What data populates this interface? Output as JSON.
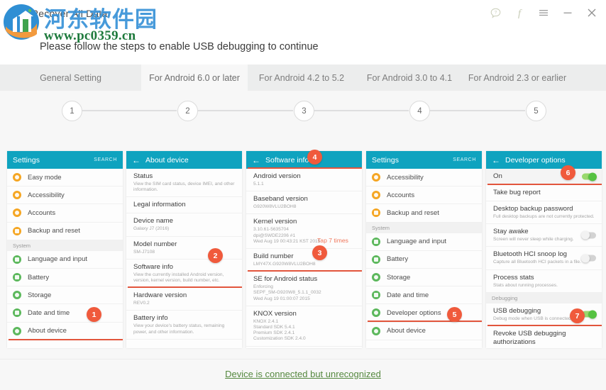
{
  "window": {
    "title": "Recover All Data",
    "watermark_cn": "河东软件园",
    "watermark_url": "www.pc0359.cn",
    "controls": [
      {
        "name": "help-icon",
        "glyph": "?"
      },
      {
        "name": "facebook-icon",
        "glyph": "f"
      },
      {
        "name": "menu-icon",
        "glyph": "≡"
      },
      {
        "name": "minimize-icon",
        "glyph": "–"
      },
      {
        "name": "close-icon",
        "glyph": "✕"
      }
    ]
  },
  "instruction": "Please follow the steps to enable USB debugging to continue",
  "tabs": [
    {
      "label": "General Setting",
      "active": false
    },
    {
      "label": "For Android 6.0 or later",
      "active": true
    },
    {
      "label": "For Android 4.2 to 5.2",
      "active": false
    },
    {
      "label": "For Android 3.0 to 4.1",
      "active": false
    },
    {
      "label": "For Android 2.3 or earlier",
      "active": false
    }
  ],
  "steps": [
    "1",
    "2",
    "3",
    "4",
    "5"
  ],
  "colors": {
    "accent_teal": "#0fa3bf",
    "badge_red": "#f05a3c",
    "underline_red": "#e2553c",
    "toggle_green": "#56c242",
    "link_green": "#55883f",
    "tap_hint": "#f0775c"
  },
  "panels": [
    {
      "name": "panel-settings-1",
      "header": {
        "title": "Settings",
        "back": false,
        "search": "SEARCH"
      },
      "badge": "1",
      "tap_hint": null,
      "rows": [
        {
          "type": "item",
          "label": "Easy mode",
          "icon_color": "#f5a623",
          "shape": "round"
        },
        {
          "type": "item",
          "label": "Accessibility",
          "icon_color": "#f5a623",
          "shape": "round"
        },
        {
          "type": "item",
          "label": "Accounts",
          "icon_color": "#f5a623",
          "shape": "round"
        },
        {
          "type": "item",
          "label": "Backup and reset",
          "icon_color": "#f5a623",
          "shape": "square"
        },
        {
          "type": "section",
          "label": "System"
        },
        {
          "type": "item",
          "label": "Language and input",
          "icon_color": "#5cb85c",
          "shape": "square"
        },
        {
          "type": "item",
          "label": "Battery",
          "icon_color": "#5cb85c",
          "shape": "square"
        },
        {
          "type": "item",
          "label": "Storage",
          "icon_color": "#5cb85c",
          "shape": "round"
        },
        {
          "type": "item",
          "label": "Date and time",
          "icon_color": "#5cb85c",
          "shape": "square"
        },
        {
          "type": "item",
          "label": "About device",
          "icon_color": "#5cb85c",
          "shape": "round",
          "highlight": true
        }
      ]
    },
    {
      "name": "panel-about-device",
      "header": {
        "title": "About device",
        "back": true,
        "search": null
      },
      "badge": "2",
      "tap_hint": null,
      "rows": [
        {
          "type": "detail",
          "title": "Status",
          "sub": "View the SIM card status, device IMEI, and other information."
        },
        {
          "type": "detail",
          "title": "Legal information",
          "sub": ""
        },
        {
          "type": "detail",
          "title": "Device name",
          "sub": "Galaxy J7 (2016)"
        },
        {
          "type": "detail",
          "title": "Model number",
          "sub": "SM-J7108"
        },
        {
          "type": "detail",
          "title": "Software info",
          "sub": "View the currently installed Android version, version, kernel version, build number, etc.",
          "highlight": true
        },
        {
          "type": "detail",
          "title": "Hardware version",
          "sub": "REV0.2"
        },
        {
          "type": "detail",
          "title": "Battery info",
          "sub": "View your device's battery status, remaining power, and other information."
        }
      ]
    },
    {
      "name": "panel-software-info",
      "header": {
        "title": "Software info",
        "back": true,
        "search": null
      },
      "badge": "3",
      "header_badge": "4",
      "tap_hint": "Tap 7 times",
      "rows": [
        {
          "type": "detail",
          "title": "Android version",
          "sub": "5.1.1"
        },
        {
          "type": "detail",
          "title": "Baseband version",
          "sub": "G920W8VLU2BOH8"
        },
        {
          "type": "detail",
          "title": "Kernel version",
          "sub": "3.10.61-5635704\ndpi@SWDE2206 #1\nWed Aug 19 00:43:21 KST 2015"
        },
        {
          "type": "detail",
          "title": "Build number",
          "sub": "LMY47X.G920W8VLU2BOH8",
          "highlight": true
        },
        {
          "type": "detail",
          "title": "SE for Android status",
          "sub": "Enforcing\nSEPF_SM-G920W8_5.1.1_0032\nWed Aug 19 01:00:07 2015"
        },
        {
          "type": "detail",
          "title": "KNOX version",
          "sub": "KNOX 2.4.1\nStandard SDK 5.4.1\nPremium SDK 2.4.1\nCustomization SDK 2.4.0"
        }
      ]
    },
    {
      "name": "panel-settings-2",
      "header": {
        "title": "Settings",
        "back": false,
        "search": "SEARCH"
      },
      "badge": "5",
      "tap_hint": null,
      "rows": [
        {
          "type": "item",
          "label": "Accessibility",
          "icon_color": "#f5a623",
          "shape": "round"
        },
        {
          "type": "item",
          "label": "Accounts",
          "icon_color": "#f5a623",
          "shape": "round"
        },
        {
          "type": "item",
          "label": "Backup and reset",
          "icon_color": "#f5a623",
          "shape": "square"
        },
        {
          "type": "section",
          "label": "System"
        },
        {
          "type": "item",
          "label": "Language and input",
          "icon_color": "#5cb85c",
          "shape": "square"
        },
        {
          "type": "item",
          "label": "Battery",
          "icon_color": "#5cb85c",
          "shape": "square"
        },
        {
          "type": "item",
          "label": "Storage",
          "icon_color": "#5cb85c",
          "shape": "round"
        },
        {
          "type": "item",
          "label": "Date and time",
          "icon_color": "#5cb85c",
          "shape": "square"
        },
        {
          "type": "item",
          "label": "Developer options",
          "icon_color": "#5cb85c",
          "shape": "round",
          "highlight": true
        },
        {
          "type": "item",
          "label": "About device",
          "icon_color": "#5cb85c",
          "shape": "round"
        }
      ]
    },
    {
      "name": "panel-developer-options",
      "header": {
        "title": "Developer options",
        "back": true,
        "search": null
      },
      "badge": "6",
      "badge2": "7",
      "tap_hint": null,
      "rows": [
        {
          "type": "detail",
          "title": "On",
          "sub": "",
          "toggle": "on",
          "master": true,
          "highlight": true
        },
        {
          "type": "detail",
          "title": "Take bug report",
          "sub": ""
        },
        {
          "type": "detail",
          "title": "Desktop backup password",
          "sub": "Full desktop backups are not currently protected."
        },
        {
          "type": "detail",
          "title": "Stay awake",
          "sub": "Screen will never sleep while charging.",
          "toggle": "off"
        },
        {
          "type": "detail",
          "title": "Bluetooth HCI snoop log",
          "sub": "Capture all Bluetooth HCI packets in a file.",
          "toggle": "off"
        },
        {
          "type": "detail",
          "title": "Process stats",
          "sub": "Stats about running processes."
        },
        {
          "type": "section",
          "label": "Debugging"
        },
        {
          "type": "detail",
          "title": "USB debugging",
          "sub": "Debug mode when USB is connected.",
          "toggle": "on",
          "highlight": true
        },
        {
          "type": "detail",
          "title": "Revoke USB debugging authorizations",
          "sub": ""
        }
      ]
    }
  ],
  "bottom_link": "Device is connected but unrecognized"
}
